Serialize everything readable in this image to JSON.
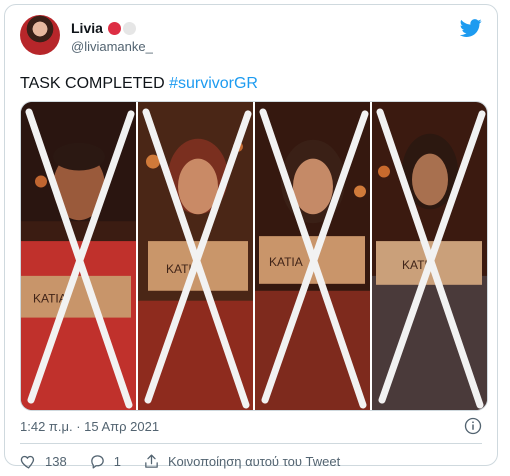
{
  "author": {
    "name": "Livia",
    "handle": "@liviamanke_"
  },
  "tweet": {
    "text_plain": "TASK COMPLETED ",
    "hashtag": "#survivorGR",
    "timestamp": "1:42 π.μ. · 15 Απρ 2021"
  },
  "media": {
    "sign_text": "KATIA",
    "panels": [
      {
        "id": "panel-1"
      },
      {
        "id": "panel-2"
      },
      {
        "id": "panel-3"
      },
      {
        "id": "panel-4"
      }
    ]
  },
  "actions": {
    "likes": "138",
    "replies": "1",
    "share_label": "Κοινοποίηση αυτού του Tweet"
  },
  "colors": {
    "accent": "#1d9bf0",
    "like_red": "#dd2e44"
  },
  "icons": [
    "twitter-bird-icon",
    "info-icon",
    "heart-icon",
    "reply-icon",
    "share-icon"
  ]
}
